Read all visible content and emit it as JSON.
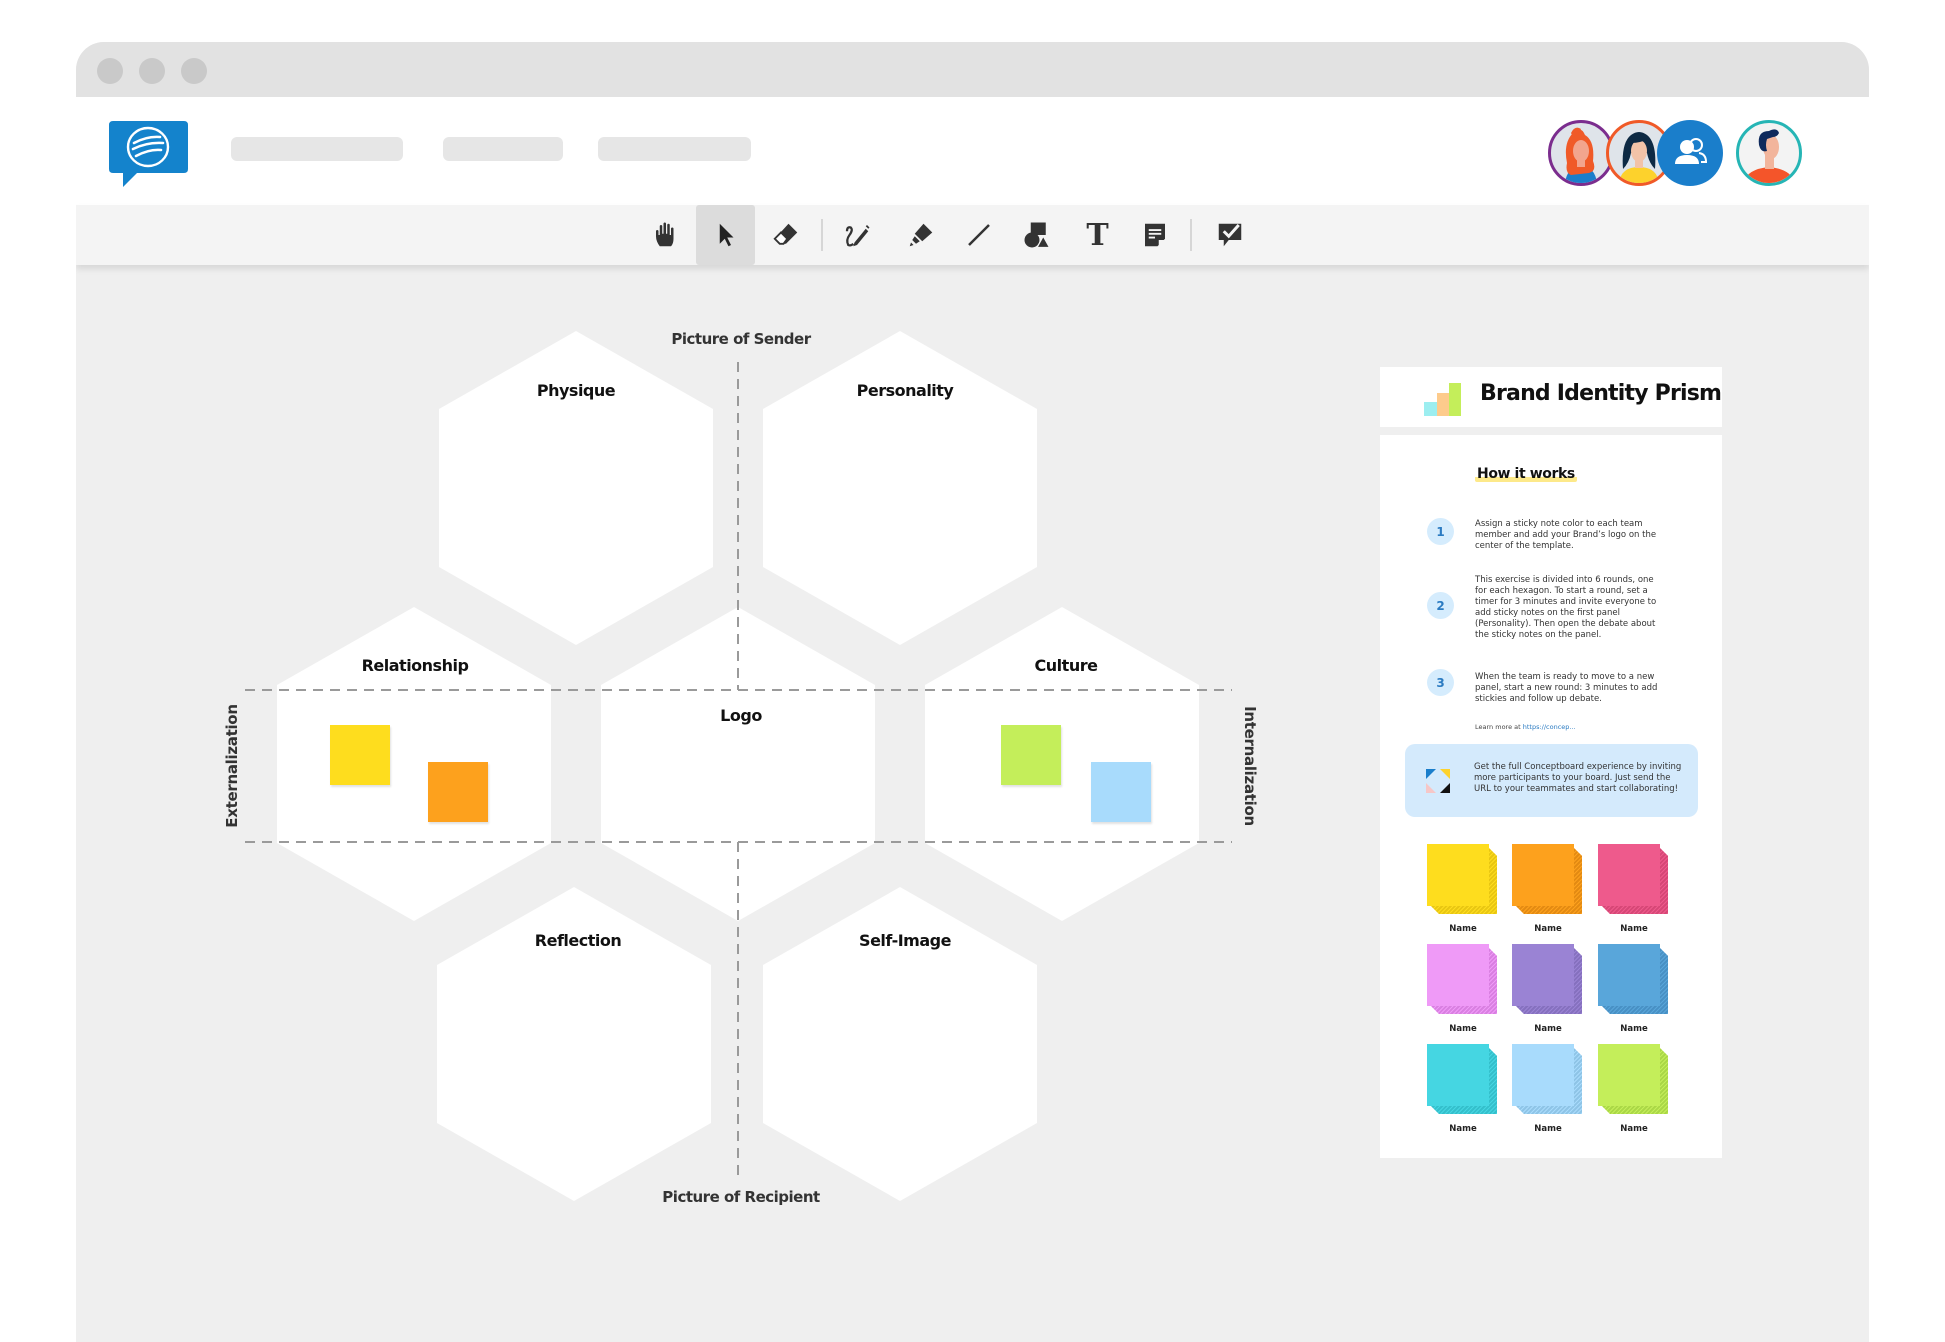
{
  "window": {
    "title_dots": [
      "close",
      "minimize",
      "maximize"
    ]
  },
  "header": {
    "logo_icon": "conceptboard-speech-bubble-logo",
    "nav_placeholders": 3,
    "participants": [
      {
        "name": "participant-1",
        "icon": "avatar-woman-red-hair",
        "ring": "#7b2d8e"
      },
      {
        "name": "participant-2",
        "icon": "avatar-woman-dark-hair",
        "ring": "#f05a28"
      },
      {
        "name": "participants-group",
        "icon": "users-group-icon",
        "bg": "#1a7ecb"
      },
      {
        "name": "current-user",
        "icon": "avatar-man-blue-hair",
        "ring": "#26b5b5"
      }
    ]
  },
  "toolbar": {
    "tools": [
      {
        "id": "hand",
        "icon": "hand-icon",
        "label": "Pan"
      },
      {
        "id": "select",
        "icon": "pointer-icon",
        "label": "Select",
        "active": true
      },
      {
        "id": "eraser",
        "icon": "eraser-icon",
        "label": "Eraser"
      },
      {
        "id": "pen",
        "icon": "pen-icon",
        "label": "Pen"
      },
      {
        "id": "marker",
        "icon": "marker-icon",
        "label": "Marker"
      },
      {
        "id": "line",
        "icon": "line-icon",
        "label": "Line"
      },
      {
        "id": "shapes",
        "icon": "shapes-icon",
        "label": "Shapes"
      },
      {
        "id": "text",
        "icon": "text-icon",
        "label": "Text"
      },
      {
        "id": "sticky",
        "icon": "sticky-note-icon",
        "label": "Sticky note"
      },
      {
        "id": "review",
        "icon": "comment-check-icon",
        "label": "Review"
      }
    ],
    "text_glyph": "T"
  },
  "board": {
    "axis_top": "Picture of Sender",
    "axis_bottom": "Picture of Recipient",
    "axis_left": "Externalization",
    "axis_right": "Internalization",
    "hexagons": [
      {
        "id": "physique",
        "label": "Physique"
      },
      {
        "id": "personality",
        "label": "Personality"
      },
      {
        "id": "relationship",
        "label": "Relationship"
      },
      {
        "id": "logo",
        "label": "Logo"
      },
      {
        "id": "culture",
        "label": "Culture"
      },
      {
        "id": "reflection",
        "label": "Reflection"
      },
      {
        "id": "self-image",
        "label": "Self-Image"
      }
    ],
    "sticky_notes": [
      {
        "hexagon": "relationship",
        "color": "#fedd1e"
      },
      {
        "hexagon": "relationship",
        "color": "#fda11d"
      },
      {
        "hexagon": "culture",
        "color": "#c4ee5a"
      },
      {
        "hexagon": "culture",
        "color": "#a8dbfc"
      }
    ]
  },
  "panel": {
    "title": "Brand Identity Prism",
    "title_icon": "bar-chart-icon",
    "how_it_works": "How it works",
    "steps": [
      {
        "num": "1",
        "text": "Assign a sticky note color to each team member and add your Brand’s logo on the center of the template."
      },
      {
        "num": "2",
        "text": "This exercise is divided into 6 rounds, one for each hexagon. To start a round, set a timer for 3 minutes and invite everyone to add sticky notes on the first panel (Personality). Then open the debate about the sticky notes on the panel."
      },
      {
        "num": "3",
        "text": "When the team is ready to move to a new panel, start a new round: 3 minutes to add stickies and follow up debate."
      }
    ],
    "learn_more_prefix": "Learn more at ",
    "learn_more_link": "https://concep...",
    "info_text": "Get the full Conceptboard experience by inviting more participants to your board. Just send the URL to your teammates and start collaborating!",
    "swatches": [
      {
        "color": "#fedd1e",
        "shade": "#e8c612",
        "name": "Name"
      },
      {
        "color": "#fda11d",
        "shade": "#e38a12",
        "name": "Name"
      },
      {
        "color": "#ee5a8c",
        "shade": "#d64776",
        "name": "Name"
      },
      {
        "color": "#ef9af7",
        "shade": "#d97fe1",
        "name": "Name"
      },
      {
        "color": "#9a83d4",
        "shade": "#8570be",
        "name": "Name"
      },
      {
        "color": "#59a6da",
        "shade": "#4890c4",
        "name": "Name"
      },
      {
        "color": "#45d6e2",
        "shade": "#34bfcb",
        "name": "Name"
      },
      {
        "color": "#a8dbfc",
        "shade": "#8ec4e6",
        "name": "Name"
      },
      {
        "color": "#c4ee5a",
        "shade": "#aad746",
        "name": "Name"
      }
    ]
  },
  "colors": {
    "brand_blue": "#1483cc",
    "canvas_bg": "#efefef",
    "hex_fill": "#ffffff",
    "dashed_line": "#9a9a9a"
  }
}
